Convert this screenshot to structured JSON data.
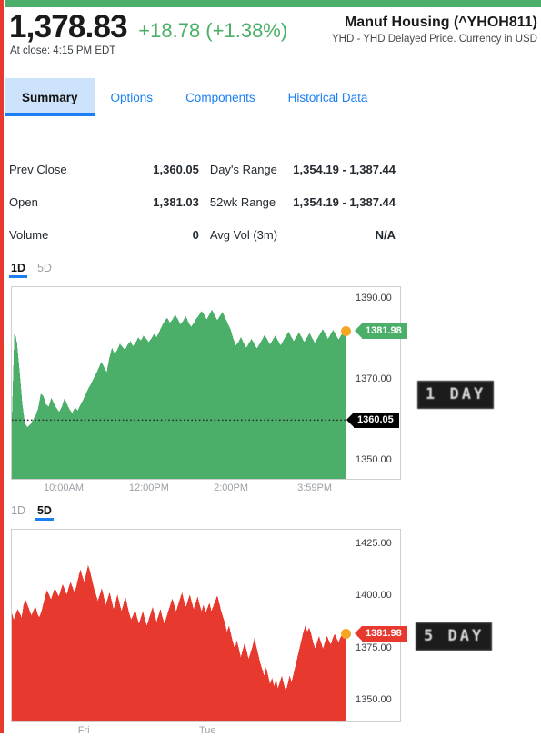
{
  "theme": {
    "positive_color": "#4caf69",
    "negative_color": "#e8392e",
    "link_color": "#1b7ff3",
    "marker_color": "#f5a623",
    "prev_close_flag_color": "#000000"
  },
  "header": {
    "last_price": "1,378.83",
    "price_change": "+18.78 (+1.38%)",
    "market_status": "At close: 4:15 PM EDT",
    "security_name": "Manuf Housing (^YHOH811)",
    "security_subtitle": "YHD - YHD Delayed Price. Currency in USD"
  },
  "nav": {
    "tabs": [
      {
        "label": "Summary",
        "active": true
      },
      {
        "label": "Options",
        "active": false
      },
      {
        "label": "Components",
        "active": false
      },
      {
        "label": "Historical Data",
        "active": false
      }
    ]
  },
  "summary": {
    "rows": [
      {
        "label_a": "Prev Close",
        "value_a": "1,360.05",
        "label_b": "Day's Range",
        "value_b": "1,354.19 - 1,387.44"
      },
      {
        "label_a": "Open",
        "value_a": "1,381.03",
        "label_b": "52wk Range",
        "value_b": "1,354.19 - 1,387.44"
      },
      {
        "label_a": "Volume",
        "value_a": "0",
        "label_b": "Avg Vol (3m)",
        "value_b": "N/A"
      }
    ]
  },
  "chart_data": [
    {
      "type": "area",
      "id": "one-day",
      "title": "1 Day",
      "watermark": "1 DAY",
      "range_options": [
        {
          "label": "1D",
          "active": true
        },
        {
          "label": "5D",
          "active": false
        }
      ],
      "color": "#4caf69",
      "grid": false,
      "ylim": [
        1345.5,
        1393.0
      ],
      "yticks": [
        "1390.00",
        "1370.00",
        "1360.00",
        "1350.00"
      ],
      "ytick_values": [
        1390.0,
        1370.0,
        1360.0,
        1350.0
      ],
      "xlabel": "",
      "ylabel": "",
      "xticks": [
        "10:00AM",
        "12:00PM",
        "2:00PM",
        "3:59PM"
      ],
      "xtick_positions": [
        0.155,
        0.41,
        0.655,
        0.905
      ],
      "last_value_flag": "1381.98",
      "last_value": 1381.98,
      "baseline_flag": "1360.05",
      "baseline_value": 1360.05,
      "values": [
        1360.3,
        1382.4,
        1379.0,
        1372.0,
        1364.0,
        1359.2,
        1358.3,
        1359.0,
        1360.0,
        1361.2,
        1363.0,
        1366.6,
        1366.0,
        1364.0,
        1363.4,
        1365.6,
        1364.2,
        1363.0,
        1362.1,
        1363.4,
        1365.5,
        1364.0,
        1362.6,
        1361.8,
        1363.2,
        1362.4,
        1363.8,
        1365.0,
        1366.4,
        1367.8,
        1369.0,
        1370.3,
        1371.6,
        1373.0,
        1374.5,
        1373.2,
        1371.9,
        1375.4,
        1378.0,
        1376.5,
        1377.4,
        1379.0,
        1378.2,
        1377.5,
        1378.8,
        1379.6,
        1378.4,
        1379.3,
        1380.5,
        1379.8,
        1381.0,
        1380.2,
        1379.4,
        1380.3,
        1381.4,
        1380.6,
        1382.0,
        1383.4,
        1384.6,
        1385.4,
        1384.2,
        1385.0,
        1386.2,
        1385.1,
        1383.8,
        1384.6,
        1385.8,
        1384.4,
        1383.2,
        1384.0,
        1385.2,
        1386.0,
        1387.1,
        1386.2,
        1385.0,
        1386.3,
        1387.4,
        1386.0,
        1384.8,
        1385.9,
        1386.8,
        1385.4,
        1384.0,
        1382.6,
        1380.4,
        1378.6,
        1379.4,
        1380.6,
        1379.2,
        1378.0,
        1379.1,
        1380.2,
        1379.0,
        1377.8,
        1378.9,
        1380.0,
        1381.2,
        1380.0,
        1378.8,
        1379.9,
        1381.0,
        1379.8,
        1378.6,
        1379.7,
        1380.8,
        1382.0,
        1380.8,
        1379.6,
        1380.7,
        1381.8,
        1380.6,
        1379.4,
        1380.5,
        1381.6,
        1380.4,
        1379.2,
        1380.3,
        1381.4,
        1382.6,
        1381.4,
        1380.2,
        1381.3,
        1382.4,
        1381.2,
        1380.0,
        1381.1,
        1382.2,
        1381.98
      ]
    },
    {
      "type": "area",
      "id": "five-day",
      "title": "5 Day",
      "watermark": "5 DAY",
      "range_options": [
        {
          "label": "1D",
          "active": false
        },
        {
          "label": "5D",
          "active": true
        }
      ],
      "color": "#e8392e",
      "grid": false,
      "ylim": [
        1340.0,
        1432.0
      ],
      "yticks": [
        "1425.00",
        "1400.00",
        "1375.00",
        "1350.00"
      ],
      "ytick_values": [
        1425.0,
        1400.0,
        1375.0,
        1350.0
      ],
      "xlabel": "",
      "ylabel": "",
      "xticks": [
        "Fri",
        "Tue"
      ],
      "xtick_positions": [
        0.215,
        0.585
      ],
      "last_value_flag": "1381.98",
      "last_value": 1381.98,
      "values": [
        1392.0,
        1389.0,
        1391.5,
        1394.0,
        1392.0,
        1390.0,
        1396.0,
        1398.5,
        1396.0,
        1393.5,
        1391.0,
        1393.0,
        1395.5,
        1392.0,
        1390.0,
        1392.5,
        1396.0,
        1400.0,
        1403.0,
        1401.0,
        1398.5,
        1401.5,
        1404.0,
        1402.0,
        1400.0,
        1403.0,
        1406.0,
        1403.5,
        1401.0,
        1404.0,
        1407.0,
        1404.5,
        1402.0,
        1405.0,
        1409.0,
        1413.0,
        1410.0,
        1407.0,
        1411.0,
        1415.0,
        1412.0,
        1408.0,
        1404.0,
        1401.0,
        1398.0,
        1401.0,
        1404.0,
        1400.0,
        1396.0,
        1399.0,
        1402.0,
        1398.0,
        1394.0,
        1397.0,
        1401.0,
        1397.0,
        1393.0,
        1396.0,
        1400.0,
        1396.0,
        1392.0,
        1389.0,
        1391.0,
        1394.0,
        1390.0,
        1387.0,
        1390.0,
        1393.0,
        1389.0,
        1386.0,
        1389.0,
        1392.0,
        1395.0,
        1391.0,
        1388.0,
        1391.0,
        1394.0,
        1390.0,
        1387.0,
        1390.0,
        1393.0,
        1396.0,
        1399.0,
        1396.0,
        1393.0,
        1396.0,
        1399.0,
        1402.0,
        1398.0,
        1395.0,
        1398.0,
        1401.0,
        1397.0,
        1394.0,
        1397.0,
        1400.0,
        1396.0,
        1393.0,
        1396.0,
        1392.0,
        1394.5,
        1397.0,
        1393.0,
        1395.5,
        1398.0,
        1400.5,
        1397.0,
        1393.0,
        1390.0,
        1387.0,
        1383.0,
        1386.0,
        1382.0,
        1378.0,
        1375.0,
        1379.0,
        1375.0,
        1371.0,
        1374.0,
        1378.0,
        1374.0,
        1370.0,
        1373.0,
        1376.0,
        1380.0,
        1376.0,
        1372.0,
        1368.0,
        1365.0,
        1362.0,
        1366.0,
        1362.0,
        1358.0,
        1361.0,
        1357.0,
        1360.0,
        1356.0,
        1359.0,
        1362.0,
        1358.0,
        1354.5,
        1358.0,
        1362.0,
        1359.0,
        1363.0,
        1367.0,
        1371.0,
        1375.0,
        1379.0,
        1383.0,
        1386.0,
        1383.0,
        1385.0,
        1382.0,
        1378.0,
        1375.0,
        1378.0,
        1381.0,
        1378.0,
        1375.0,
        1378.0,
        1381.0,
        1379.0,
        1377.0,
        1380.0,
        1382.0,
        1380.0,
        1378.0,
        1380.5,
        1382.0,
        1380.0,
        1381.98
      ]
    }
  ]
}
